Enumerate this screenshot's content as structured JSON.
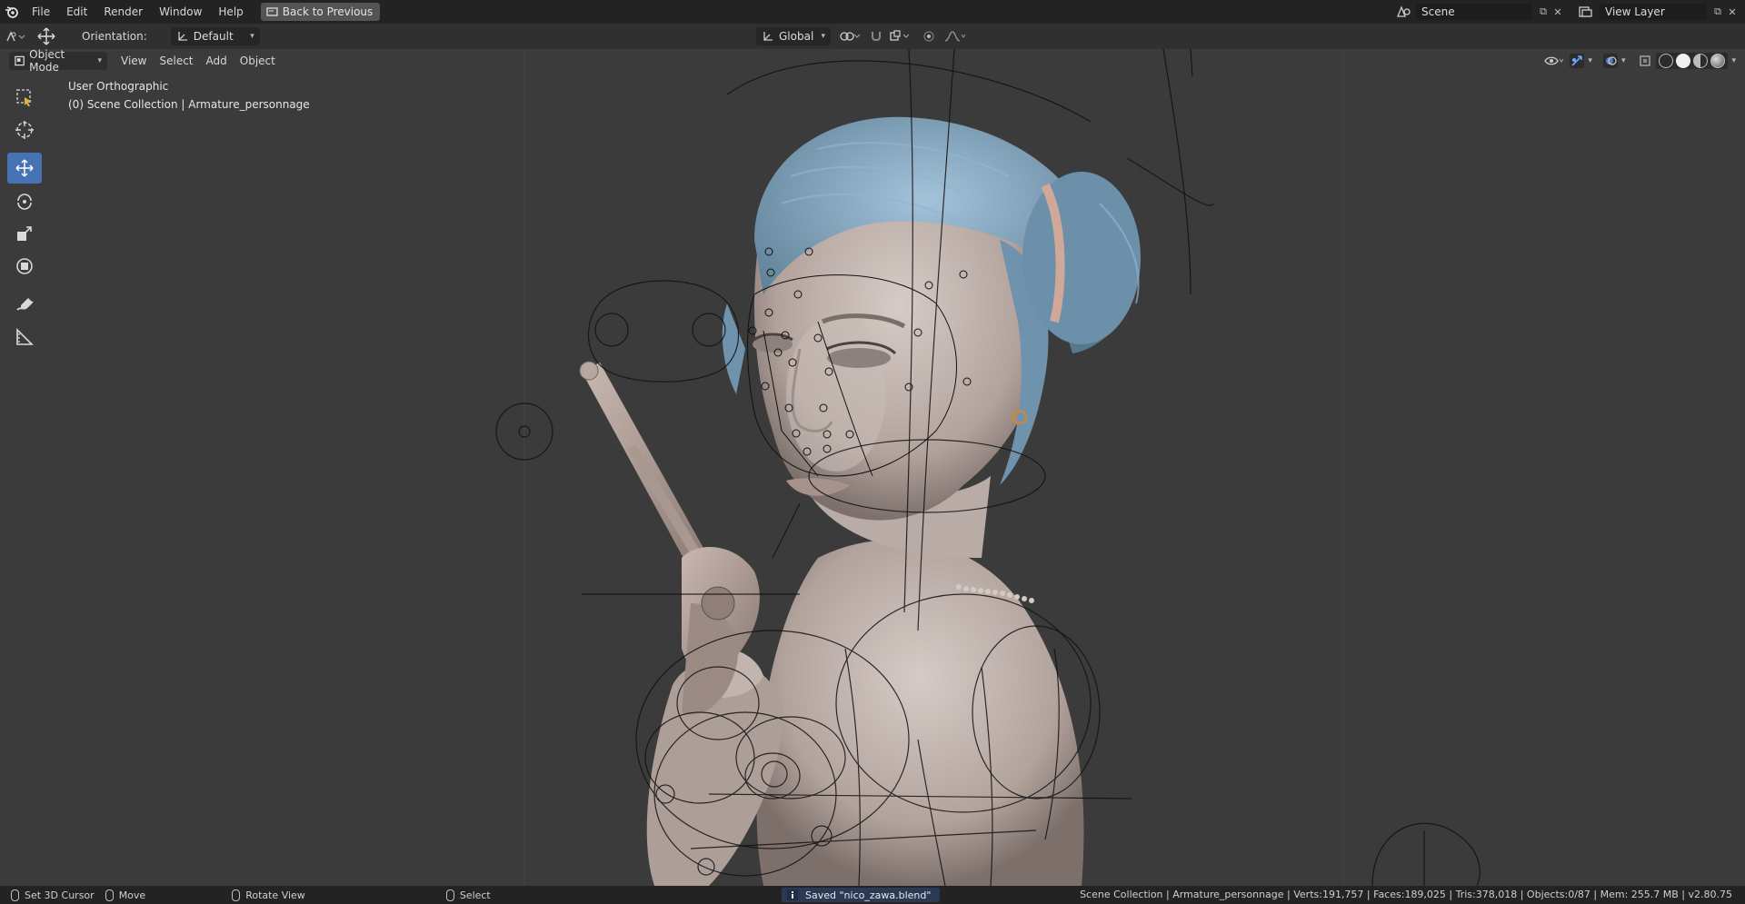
{
  "menubar": {
    "items": [
      "File",
      "Edit",
      "Render",
      "Window",
      "Help"
    ],
    "back_button": "Back to Previous",
    "scene_name": "Scene",
    "view_layer": "View Layer"
  },
  "tool_header": {
    "orientation_label": "Orientation:",
    "orientation_value": "Default",
    "transform_orientation": "Global"
  },
  "viewport_header": {
    "mode": "Object Mode",
    "menus": [
      "View",
      "Select",
      "Add",
      "Object"
    ]
  },
  "viewport": {
    "view_name": "User Orthographic",
    "collection_info": "(0) Scene Collection | Armature_personnage"
  },
  "toolbar": {
    "tools": [
      "select-box",
      "cursor",
      "move",
      "rotate",
      "scale",
      "transform",
      "annotate",
      "measure"
    ],
    "active_tool": "move"
  },
  "statusbar": {
    "left_action": "Set 3D Cursor",
    "middle_action": "Move",
    "right_action": "Rotate View",
    "select_action": "Select",
    "report": "Saved \"nico_zawa.blend\"",
    "stats": "Scene Collection | Armature_personnage | Verts:191,757 | Faces:189,025 | Tris:378,018 | Objects:0/87 | Mem: 255.7 MB | v2.80.75"
  },
  "colors": {
    "accent": "#4772b3",
    "hair": "#7fa7c4",
    "skin": "#bfb2ac",
    "viewport_bg": "#3b3b3b"
  }
}
